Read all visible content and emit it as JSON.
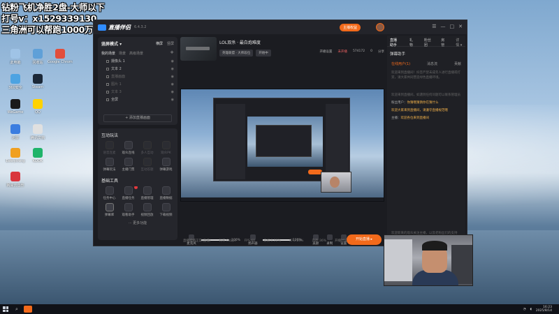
{
  "overlay": {
    "line1": "钻粉飞机净胜2盘-大师以下",
    "line2": "打号v：x1529339130",
    "line3": "三角洲可以帮跑1000万"
  },
  "desktop_icons": [
    {
      "label": "此电脑",
      "color": "#9fc3e6"
    },
    {
      "label": "回收站",
      "color": "#5fa0d8"
    },
    {
      "label": "Google Chrome",
      "color": "#e24e3c"
    },
    {
      "label": "360安全",
      "color": "#4ca3e2"
    },
    {
      "label": "Steam",
      "color": "#1b2838"
    },
    {
      "label": "WeGame",
      "color": "#1a1a1a"
    },
    {
      "label": "QQ",
      "color": "#ffd200"
    },
    {
      "label": "迅雷",
      "color": "#3b7de0"
    },
    {
      "label": "腾讯文档",
      "color": "#e0e0e0"
    },
    {
      "label": "Everything",
      "color": "#f0a020"
    },
    {
      "label": "KOOK",
      "color": "#1fb46a"
    },
    {
      "label": "网易云音乐",
      "color": "#d9363e"
    }
  ],
  "app": {
    "brand": "直播伴侣",
    "version": "6.4.3.2",
    "top_button": "主播权益",
    "window_controls": [
      "☰",
      "—",
      "□",
      "✕"
    ]
  },
  "scene_panel": {
    "title": "竖屏模式 ▾",
    "tabs": [
      "横屏",
      "竖屏"
    ],
    "subtabs": [
      "我的场景",
      "场景",
      "高级场景"
    ],
    "sources": [
      {
        "name": "摄像头 1",
        "dim": false
      },
      {
        "name": "文本 2",
        "dim": false
      },
      {
        "name": "直播画面",
        "dim": true
      },
      {
        "name": "图片 1",
        "dim": true
      },
      {
        "name": "文本 3",
        "dim": true
      },
      {
        "name": "全屏",
        "dim": false
      }
    ],
    "add_source": "+ 添加直播画面"
  },
  "tools_panel": {
    "interactive_title": "互动玩法",
    "interactive": [
      {
        "label": "语音连麦",
        "dim": true
      },
      {
        "label": "观众连线",
        "dim": false
      },
      {
        "label": "多人互动",
        "dim": true
      },
      {
        "label": "观众PK",
        "dim": true
      },
      {
        "label": "弹幕玩法",
        "dim": false
      },
      {
        "label": "主播门票",
        "dim": false
      },
      {
        "label": "互动答题",
        "dim": true
      },
      {
        "label": "弹幕游戏",
        "dim": false
      }
    ],
    "basic_title": "基础工具",
    "basic": [
      {
        "label": "任务中心",
        "dim": false,
        "badge": false
      },
      {
        "label": "直播任务",
        "dim": false,
        "badge": true
      },
      {
        "label": "直播管理",
        "dim": false,
        "badge": false
      },
      {
        "label": "直播数据",
        "dim": false,
        "badge": false
      },
      {
        "label": "弹幕库",
        "dim": false,
        "badge": false,
        "selected": true
      },
      {
        "label": "观看助手",
        "dim": false,
        "badge": false
      },
      {
        "label": "视频回放",
        "dim": false,
        "badge": false
      },
      {
        "label": "下载视频",
        "dim": false,
        "badge": false
      }
    ],
    "more": "··· 更多功能"
  },
  "stream": {
    "title": "LOL双杀 · 最白炮难度",
    "tags": [
      "英雄联盟 · 大师段位",
      "开始中"
    ],
    "stats": [
      "开播设置",
      "未开播",
      "574172",
      "0",
      "分享"
    ]
  },
  "controls": {
    "mic_label": "麦克风",
    "mic_volume": "100%",
    "speaker_label": "扬声器",
    "speaker_volume": "100%",
    "mic_level": 1.0,
    "speaker_level": 1.0,
    "buttons": [
      "美颜",
      "录制",
      "设置"
    ],
    "go_live": "开始直播 ▸"
  },
  "statusbar": [
    "直播网络正常(直播)",
    "码率:0kbps",
    "FPS:60",
    "丢帧:0.00%",
    "CPU:24%",
    "内存:36%",
    "开播时长"
  ],
  "right_panel": {
    "tabs": [
      "直播助手",
      "礼物",
      "粉丝团",
      "房管"
    ],
    "menu": "详情 ▾",
    "helper_title": "弹幕助手",
    "subtabs": [
      "在线用户(1)",
      "消息流",
      "贡献"
    ],
    "notice": "欢迎来到直播间！抖音严禁未成年人进行直播或打赏，请大家共同营造绿色直播环境。",
    "system_msg": "欢迎来到直播间，如遇到任何问题可以联系管理员",
    "messages": [
      {
        "user": "粉丝用户：",
        "text": "你猜哦猜猜你在猜什么"
      },
      {
        "user": "",
        "text": "欢迎大家来到直播间，请遵守直播规范哦"
      },
      {
        "user": "主播：",
        "text": "欢迎各位来到直播间"
      }
    ],
    "footer": "欢迎新来的观众关注主播，以及老粉丝们的支持"
  },
  "taskbar": {
    "time": "16:23",
    "date": "2025/8/14"
  }
}
